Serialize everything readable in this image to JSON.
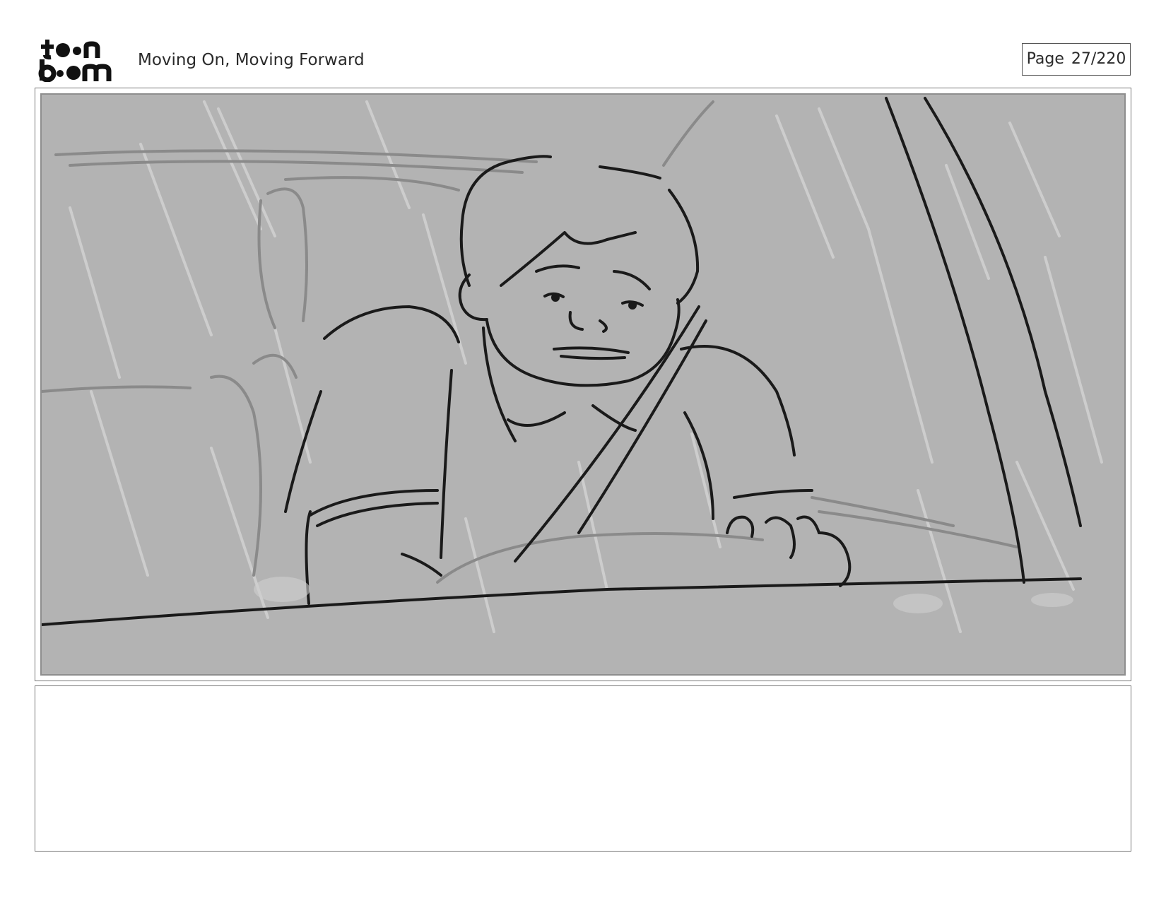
{
  "header": {
    "brand": "toon boom",
    "project_title": "Moving On, Moving Forward",
    "page_label": "Page",
    "page_number": "27/220"
  },
  "panel": {
    "icon": "storyboard-sketch-image",
    "background_color": "#b3b3b3"
  },
  "notes": {
    "text": ""
  }
}
